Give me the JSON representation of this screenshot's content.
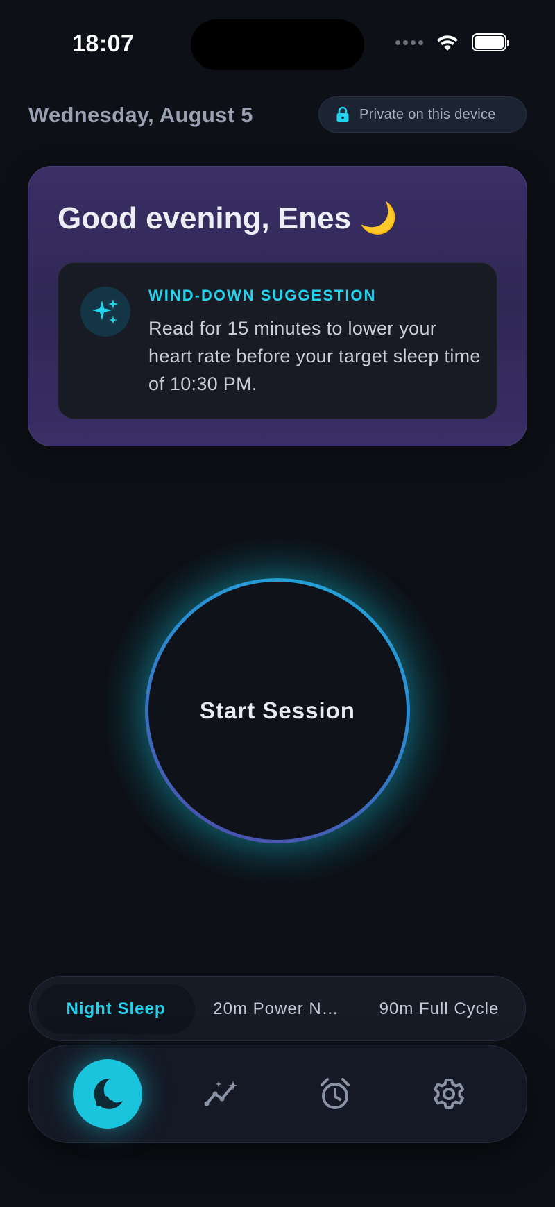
{
  "status_bar": {
    "time": "18:07"
  },
  "header": {
    "date": "Wednesday, August 5",
    "privacy_label": "Private on this device"
  },
  "greeting": {
    "title": "Good evening, Enes 🌙",
    "suggestion": {
      "label": "WIND-DOWN SUGGESTION",
      "text": "Read for 15 minutes to lower your heart rate before your target sleep time of 10:30 PM."
    }
  },
  "session": {
    "button_label": "Start Session"
  },
  "modes": {
    "items": [
      {
        "label": "Night Sleep",
        "active": true
      },
      {
        "label": "20m Power N…",
        "active": false
      },
      {
        "label": "90m Full Cycle",
        "active": false
      }
    ]
  },
  "tabbar": {
    "items": [
      {
        "icon": "moon-icon",
        "active": true
      },
      {
        "icon": "chart-icon",
        "active": false
      },
      {
        "icon": "alarm-icon",
        "active": false
      },
      {
        "icon": "gear-icon",
        "active": false
      }
    ]
  },
  "colors": {
    "background": "#0d1016",
    "accent": "#22d3ee",
    "card": "#3b2f66"
  }
}
